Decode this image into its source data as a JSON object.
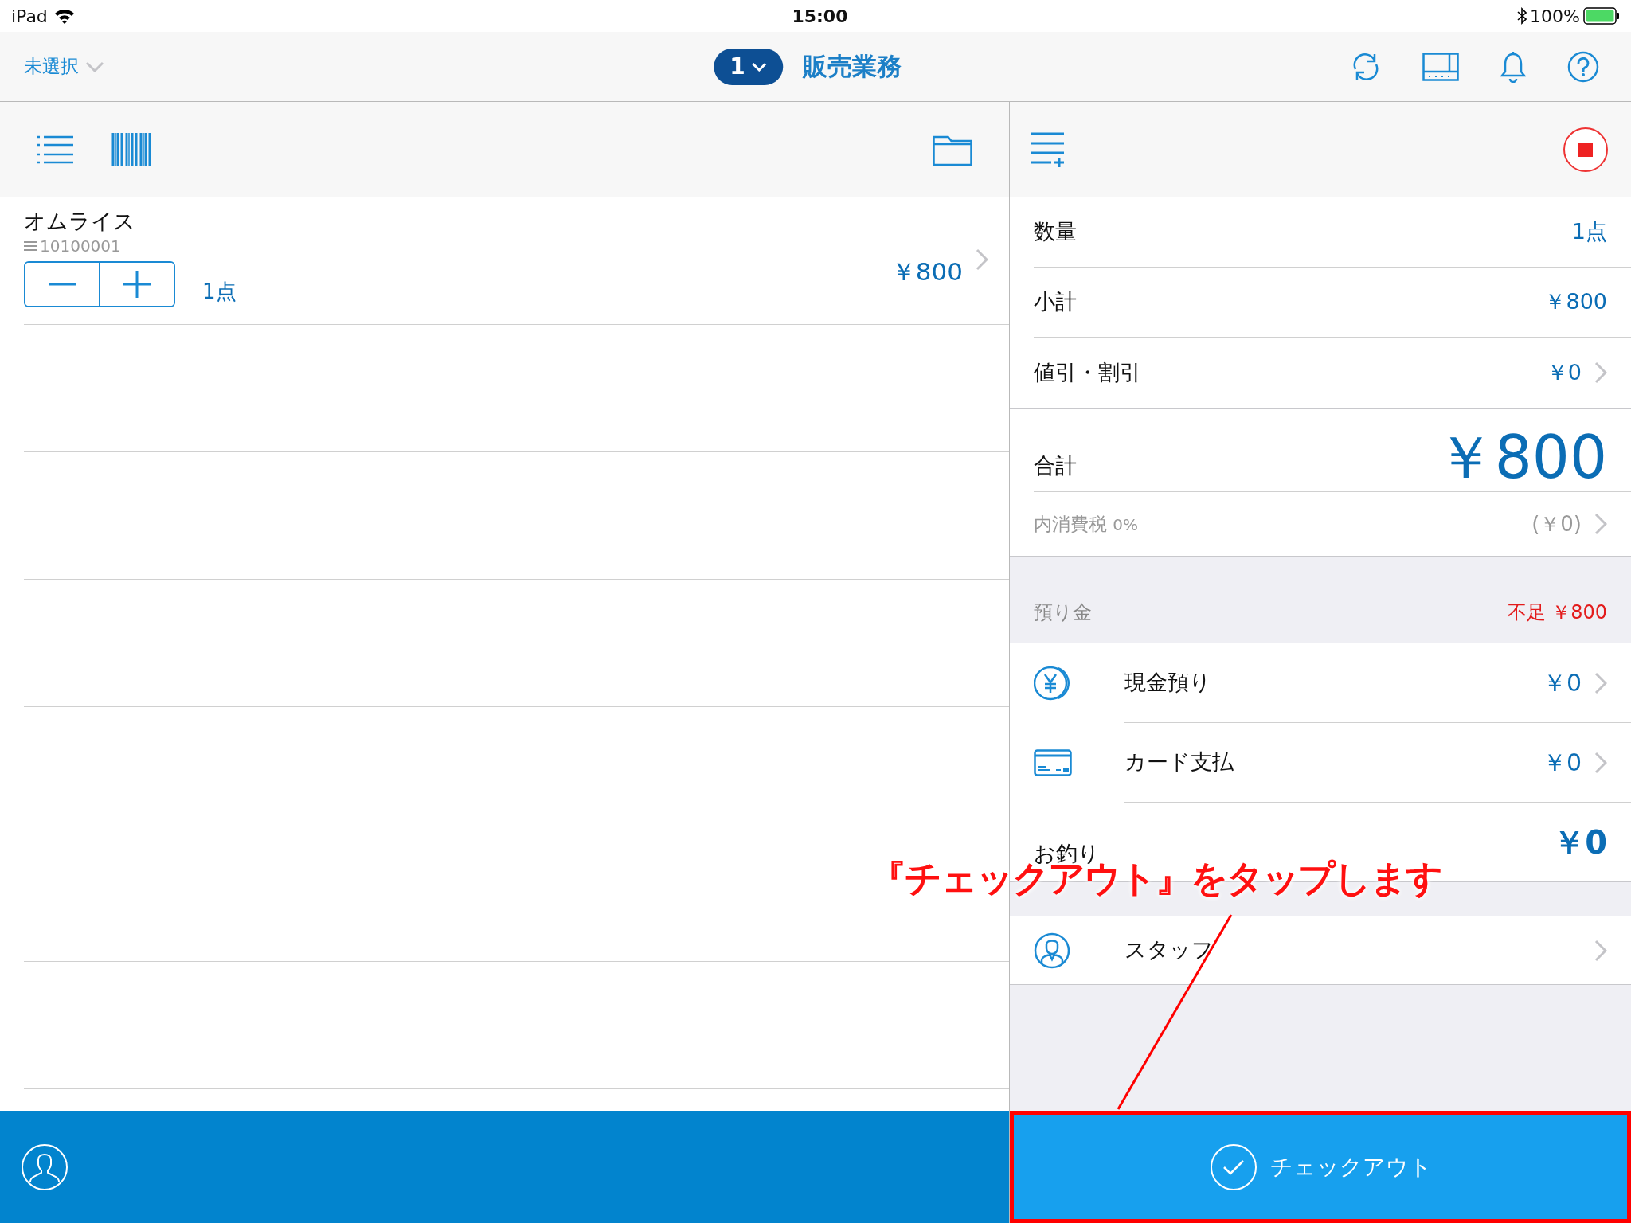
{
  "status_bar": {
    "device": "iPad",
    "time": "15:00",
    "battery": "100%"
  },
  "nav": {
    "store": "未選択",
    "register_badge": "1",
    "title": "販売業務"
  },
  "cart_items": [
    {
      "name": "オムライス",
      "code": "10100001",
      "price": "￥800",
      "quantity": "1点"
    }
  ],
  "summary": [
    {
      "label": "数量",
      "value": "1点",
      "disclosure": false
    },
    {
      "label": "小計",
      "value": "￥800",
      "disclosure": false
    },
    {
      "label": "値引・割引",
      "value": "￥0",
      "disclosure": true
    }
  ],
  "total": {
    "label": "合計",
    "value": "￥800"
  },
  "tax": {
    "label": "内消費税",
    "rate": "0%",
    "value": "(￥0)"
  },
  "deposit": {
    "label": "預り金",
    "status": "不足 ￥800"
  },
  "payments": [
    {
      "kind": "cash",
      "label": "現金預り",
      "value": "￥0"
    },
    {
      "kind": "card",
      "label": "カード支払",
      "value": "￥0"
    }
  ],
  "change": {
    "label": "お釣り",
    "value": "￥0"
  },
  "staff": {
    "label": "スタッフ"
  },
  "checkout": {
    "label": "チェックアウト"
  },
  "annotation": {
    "text": "『チェックアウト』をタップします"
  }
}
